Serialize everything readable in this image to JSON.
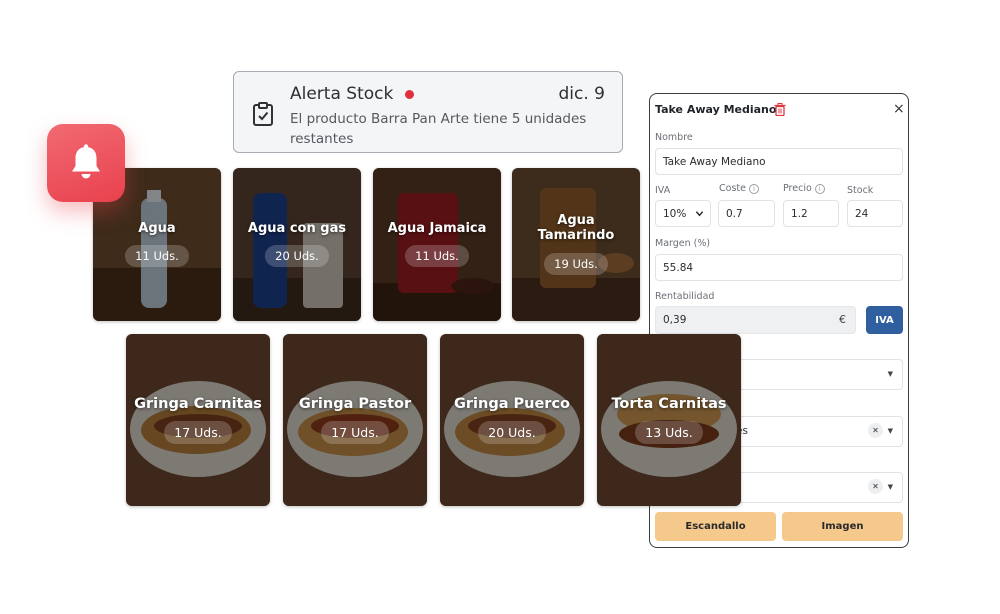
{
  "alert": {
    "title": "Alerta Stock",
    "date": "dic. 9",
    "message": "El producto Barra Pan Arte tiene 5 unidades restantes",
    "icon": "clipboard-check-icon",
    "dot_color": "#e0303c"
  },
  "bell_badge": {
    "icon": "bell-icon",
    "color": "#e8414d"
  },
  "products": [
    {
      "name": "Agua",
      "units": "11 Uds."
    },
    {
      "name": "Agua con gas",
      "units": "20 Uds."
    },
    {
      "name": "Agua Jamaica",
      "units": "11 Uds."
    },
    {
      "name": "Agua Tamarindo",
      "units": "19 Uds."
    },
    {
      "name": "Gringa Carnitas",
      "units": "17 Uds."
    },
    {
      "name": "Gringa Pastor",
      "units": "17 Uds."
    },
    {
      "name": "Gringa Puerco",
      "units": "20 Uds."
    },
    {
      "name": "Torta Carnitas",
      "units": "13 Uds."
    }
  ],
  "panel": {
    "title": "Take Away Mediano",
    "close_symbol": "×",
    "nombre_label": "Nombre",
    "nombre_value": "Take Away Mediano",
    "iva_label": "IVA",
    "iva_value": "10%",
    "coste_label": "Coste",
    "coste_value": "0.7",
    "precio_label": "Precio",
    "precio_value": "1.2",
    "stock_label": "Stock",
    "stock_value": "24",
    "margen_label": "Margen (%)",
    "margen_value": "55.84",
    "rentabilidad_label": "Rentabilidad",
    "rentabilidad_value": "0,39",
    "currency_symbol": "€",
    "iva_button": "IVA",
    "select2_partial": "es",
    "escandallo_button": "Escandallo",
    "imagen_button": "Imagen",
    "accent_color": "#2f5f9e",
    "button_color": "#f5c98b"
  }
}
